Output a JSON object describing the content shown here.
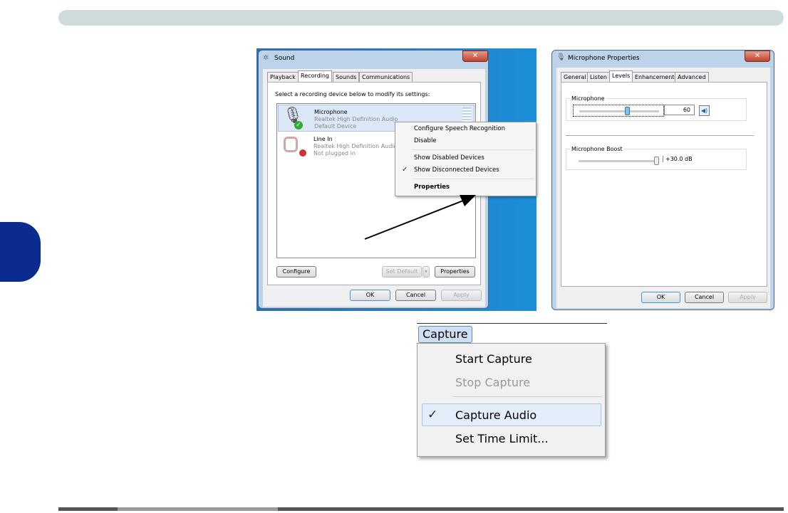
{
  "sound": {
    "title": "Sound",
    "tabs": [
      "Playback",
      "Recording",
      "Sounds",
      "Communications"
    ],
    "instruction": "Select a recording device below to modify its settings:",
    "devices": [
      {
        "name": "Microphone",
        "driver": "Realtek High Definition Audio",
        "status": "Default Device"
      },
      {
        "name": "Line In",
        "driver": "Realtek High Definition Audio",
        "status": "Not plugged in"
      }
    ],
    "context_menu": [
      "Configure Speech Recognition",
      "Disable",
      "Show Disabled Devices",
      "Show Disconnected Devices",
      "Properties"
    ],
    "check": "✓",
    "buttons": {
      "configure": "Configure",
      "set_default": "Set Default",
      "properties": "Properties",
      "ok": "OK",
      "cancel": "Cancel",
      "apply": "Apply"
    }
  },
  "mic": {
    "title": "Microphone Properties",
    "tabs": [
      "General",
      "Listen",
      "Levels",
      "Enhancements",
      "Advanced"
    ],
    "mic_label": "Microphone",
    "mic_value": "60",
    "mic_level": 60,
    "boost_label": "Microphone Boost",
    "boost_value": "+30.0 dB",
    "buttons": {
      "ok": "OK",
      "cancel": "Cancel",
      "apply": "Apply"
    }
  },
  "capture": {
    "menu": "Capture",
    "items": [
      "Start Capture",
      "Stop Capture",
      "Capture Audio",
      "Set Time Limit..."
    ],
    "check": "✓"
  }
}
